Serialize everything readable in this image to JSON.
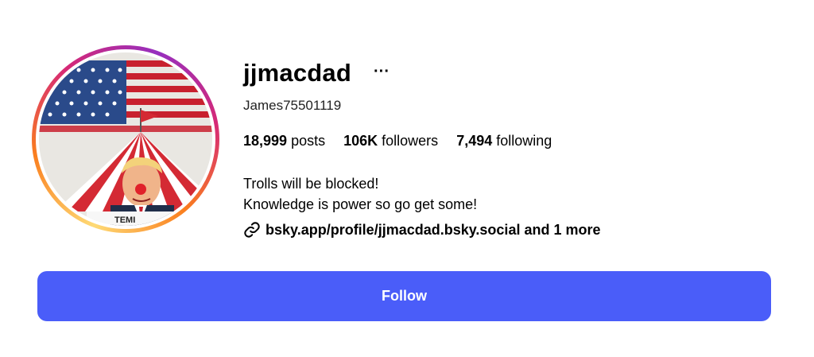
{
  "profile": {
    "username": "jjmacdad",
    "more_icon": "more-horizontal-icon",
    "handle": "James75501119",
    "stats": {
      "posts_count": "18,999",
      "posts_label": "posts",
      "followers_count": "106K",
      "followers_label": "followers",
      "following_count": "7,494",
      "following_label": "following"
    },
    "bio": {
      "line1": "Trolls will be blocked!",
      "line2": "Knowledge is power so go get some!"
    },
    "link": {
      "icon": "link-icon",
      "text": "bsky.app/profile/jjmacdad.bsky.social and 1 more"
    }
  },
  "actions": {
    "follow_label": "Follow"
  },
  "colors": {
    "follow_button": "#4a5df9",
    "story_ring_start": "#feda75",
    "story_ring_end": "#d62976"
  }
}
